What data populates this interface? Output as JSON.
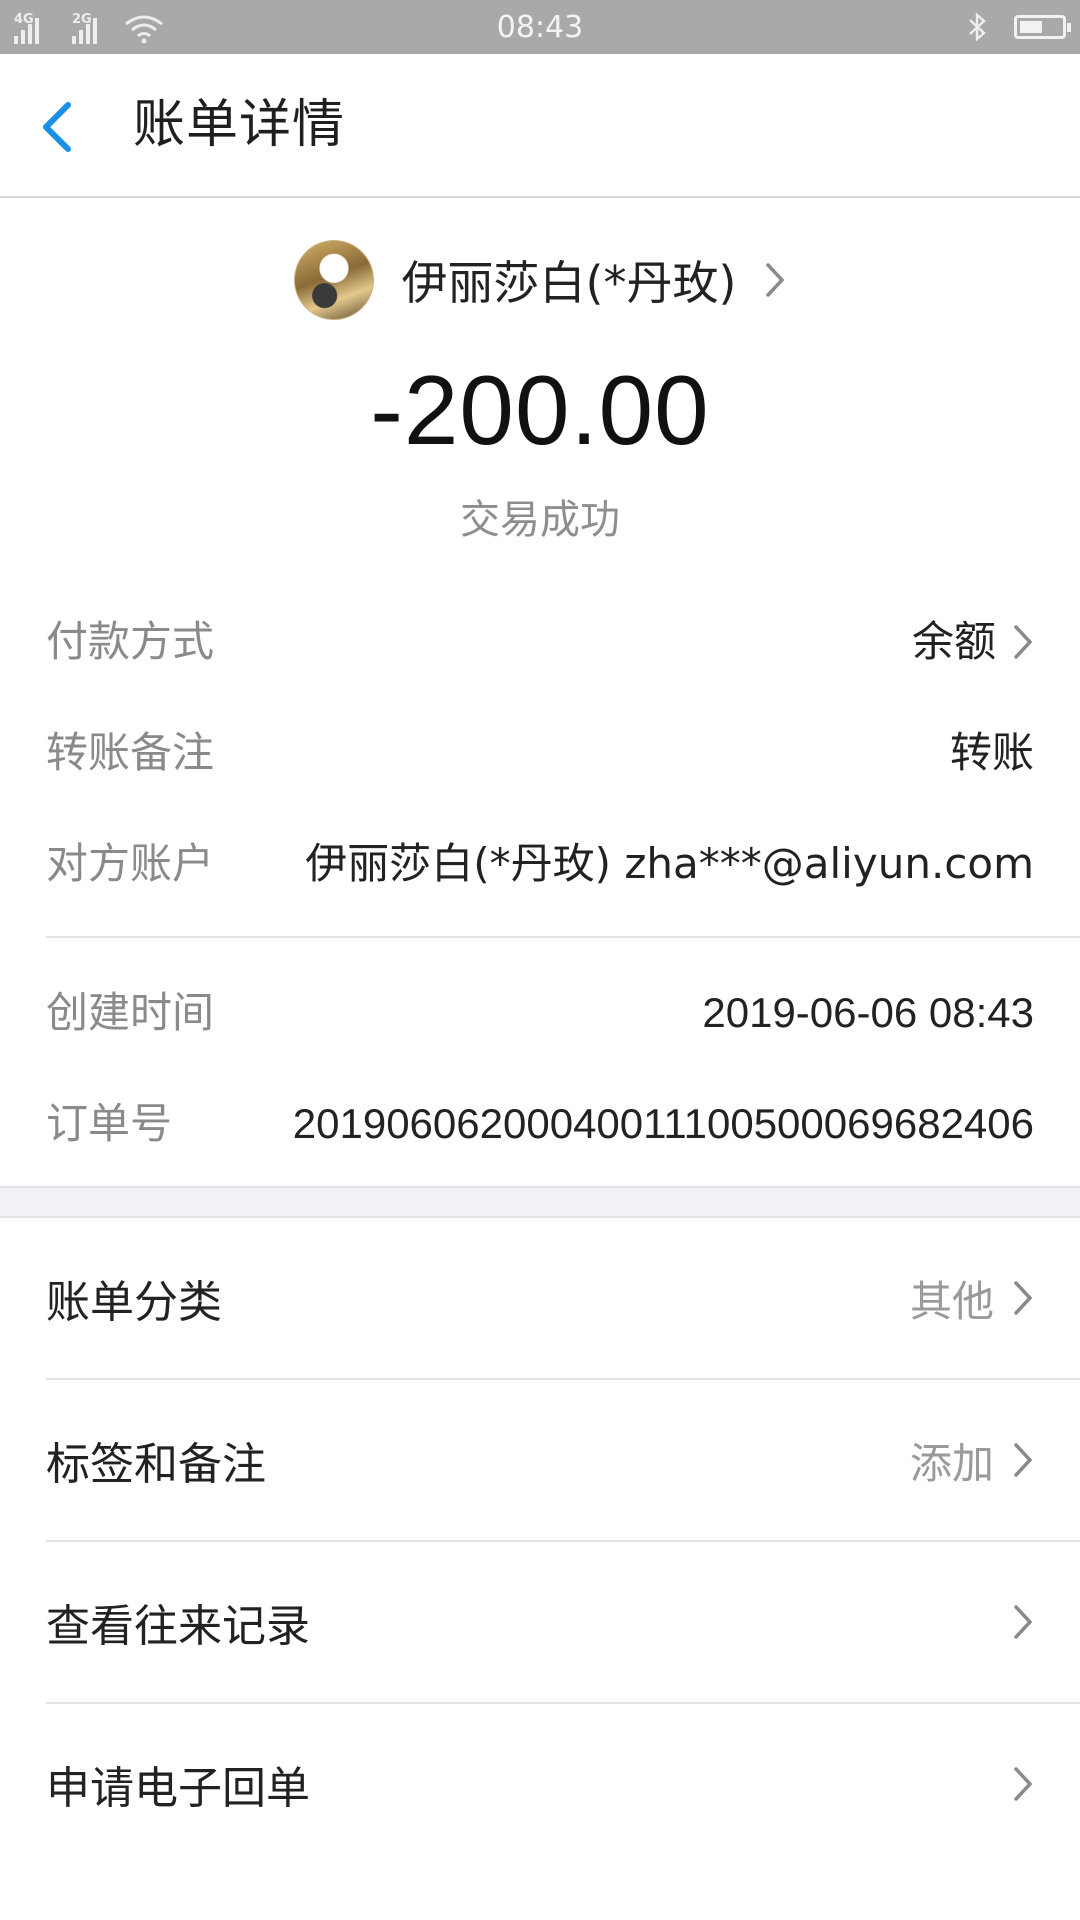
{
  "status_bar": {
    "time": "08:43",
    "sim1": "4G",
    "sim2": "2G",
    "icons": [
      "signal-icon",
      "signal-icon",
      "wifi-icon",
      "bluetooth-icon",
      "battery-icon"
    ]
  },
  "header": {
    "title": "账单详情"
  },
  "summary": {
    "payee_name": "伊丽莎白(*丹玫)",
    "amount": "-200.00",
    "status": "交易成功"
  },
  "details": {
    "payment_method_label": "付款方式",
    "payment_method_value": "余额",
    "note_label": "转账备注",
    "note_value": "转账",
    "account_label": "对方账户",
    "account_value": "伊丽莎白(*丹玫) zha***@aliyun.com",
    "created_label": "创建时间",
    "created_value": "2019-06-06 08:43",
    "order_label": "订单号",
    "order_value": "20190606200040011100500069682406"
  },
  "menu": {
    "category_label": "账单分类",
    "category_value": "其他",
    "tags_label": "标签和备注",
    "tags_value": "添加",
    "history_label": "查看往来记录",
    "receipt_label": "申请电子回单"
  },
  "colors": {
    "accent": "#1a8fe6",
    "status_bar": "#a9a9a9",
    "muted_text": "#8a8a8a",
    "divider": "#e3e3e3"
  }
}
